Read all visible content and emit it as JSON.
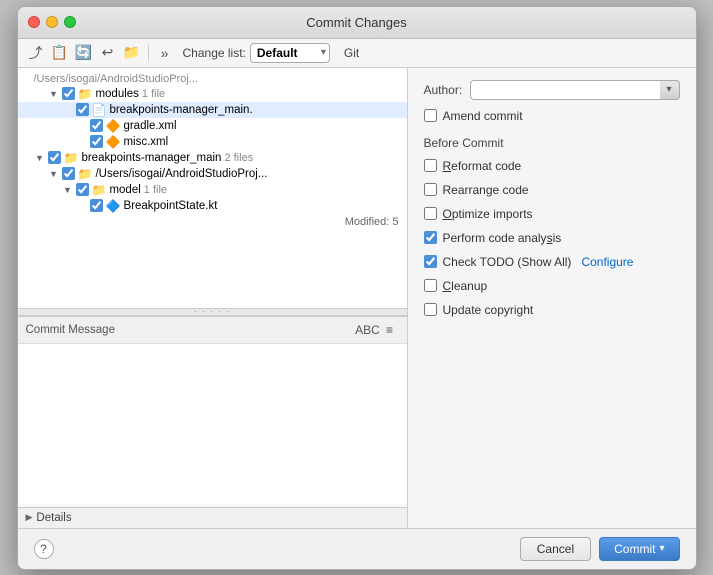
{
  "window": {
    "title": "Commit Changes"
  },
  "toolbar": {
    "changelist_label": "Change list:",
    "changelist_value": "Default",
    "git_tab": "Git"
  },
  "file_tree": {
    "items": [
      {
        "indent": 2,
        "arrow": "▼",
        "checked": true,
        "type": "folder",
        "name": "modules",
        "count": "1 file",
        "path": "/Users/isogai/AndroidStudioProj..."
      },
      {
        "indent": 3,
        "arrow": "",
        "checked": true,
        "type": "file",
        "name": "breakpoints-manager_main.",
        "count": "",
        "path": ""
      },
      {
        "indent": 4,
        "arrow": "",
        "checked": true,
        "type": "xml",
        "name": "gradle.xml",
        "count": "",
        "path": ""
      },
      {
        "indent": 4,
        "arrow": "",
        "checked": true,
        "type": "xml",
        "name": "misc.xml",
        "count": "",
        "path": ""
      },
      {
        "indent": 1,
        "arrow": "▼",
        "checked": true,
        "type": "folder",
        "name": "breakpoints-manager_main",
        "count": "2 files",
        "path": ""
      },
      {
        "indent": 2,
        "arrow": "▼",
        "checked": true,
        "type": "folder",
        "name": "/Users/isogai/AndroidStudioProj...",
        "count": "",
        "path": ""
      },
      {
        "indent": 3,
        "arrow": "▼",
        "checked": true,
        "type": "folder",
        "name": "model",
        "count": "1 file",
        "path": ""
      },
      {
        "indent": 4,
        "arrow": "",
        "checked": true,
        "type": "kt",
        "name": "BreakpointState.kt",
        "count": "",
        "path": ""
      }
    ],
    "modified": "Modified: 5"
  },
  "commit_message": {
    "label": "Commit Message",
    "placeholder": "",
    "value": ""
  },
  "details": {
    "label": "Details"
  },
  "right_panel": {
    "author_label": "Author:",
    "author_placeholder": "",
    "amend_label": "Amend commit",
    "before_commit_label": "Before Commit",
    "options": [
      {
        "id": "reformat",
        "label": "Reformat code",
        "checked": false
      },
      {
        "id": "rearrange",
        "label": "Rearrange code",
        "checked": false
      },
      {
        "id": "optimize",
        "label": "Optimize imports",
        "checked": false
      },
      {
        "id": "analyze",
        "label": "Perform code analysis",
        "checked": true
      },
      {
        "id": "todo",
        "label": "Check TODO (Show All)",
        "checked": true,
        "configure": "Configure"
      },
      {
        "id": "cleanup",
        "label": "Cleanup",
        "checked": false
      },
      {
        "id": "copyright",
        "label": "Update copyright",
        "checked": false
      }
    ]
  },
  "footer": {
    "cancel_label": "Cancel",
    "commit_label": "Commit"
  }
}
